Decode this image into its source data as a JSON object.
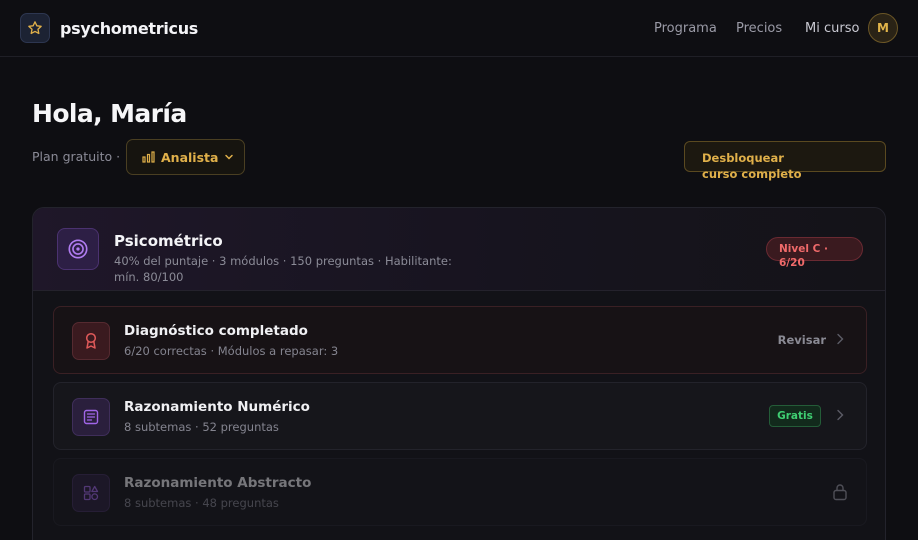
{
  "header": {
    "brand": "psychometricus",
    "nav": [
      {
        "label": "Programa"
      },
      {
        "label": "Precios"
      },
      {
        "label": "Mi curso"
      }
    ],
    "avatar_initial": "M",
    "logo_icon": "star-icon"
  },
  "greeting": {
    "title": "Hola, María",
    "plan_label": "Plan gratuito ·",
    "plan_selected": "Analista",
    "unlock_label": "Desbloquear curso completo"
  },
  "module": {
    "title": "Psicométrico",
    "description": "40% del puntaje · 3 módulos · 150 preguntas · Habilitante: mín. 80/100",
    "badge": "Nivel C · 6/20",
    "icon": "target-icon",
    "rows": [
      {
        "title": "Diagnóstico completado",
        "subtitle": "6/20 correctas · Módulos a repasar: 3",
        "action": "Revisar",
        "icon": "award-icon"
      },
      {
        "title": "Razonamiento Numérico",
        "subtitle": "8 subtemas · 52 preguntas",
        "badge": "Gratis",
        "icon": "calculator-icon"
      },
      {
        "title": "Razonamiento Abstracto",
        "subtitle": "8 subtemas · 48 preguntas",
        "icon": "shapes-icon",
        "locked": true
      }
    ]
  },
  "colors": {
    "accent_gold": "#e0b04a",
    "accent_purple": "#a066e8",
    "danger": "#f06a6a",
    "success": "#3fce72",
    "background": "#0e0e12"
  }
}
